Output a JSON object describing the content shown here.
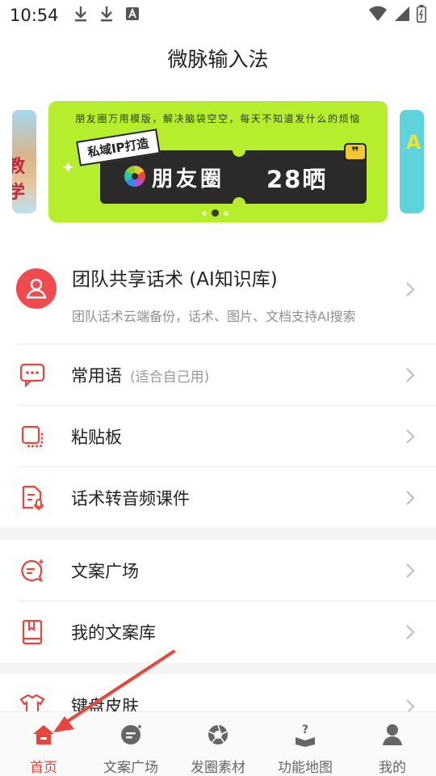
{
  "status_bar": {
    "time": "10:54"
  },
  "app_bar": {
    "title": "微脉输入法"
  },
  "banner": {
    "subtitle": "朋友圈万用模版，解决脑袋空空，每天不知道发什么的烦恼",
    "tag": "私域IP打造",
    "main_text": "朋友圈",
    "count_text": "28晒",
    "left_peek_text": "教学",
    "right_peek_text": "A",
    "dot_count": 3,
    "active_dot": 1
  },
  "team_item": {
    "title": "团队共享话术 (AI知识库)",
    "subtitle": "团队话术云端备份，话术、图片、文档支持AI搜索"
  },
  "menu_group1": [
    {
      "label": "常用语",
      "hint": "(适合自己用)",
      "icon": "chat-bubble-icon"
    },
    {
      "label": "粘贴板",
      "hint": "",
      "icon": "clipboard-icon"
    },
    {
      "label": "话术转音频课件",
      "hint": "",
      "icon": "audio-file-icon"
    }
  ],
  "menu_group2": [
    {
      "label": "文案广场",
      "hint": "",
      "icon": "sparkle-chat-icon"
    },
    {
      "label": "我的文案库",
      "hint": "",
      "icon": "book-icon"
    }
  ],
  "menu_group3": [
    {
      "label": "键盘皮肤",
      "hint": "",
      "icon": "tshirt-icon"
    }
  ],
  "tab_bar": [
    {
      "label": "首页",
      "icon": "home-icon",
      "active": true
    },
    {
      "label": "文案广场",
      "icon": "chat-icon",
      "active": false
    },
    {
      "label": "发圈素材",
      "icon": "shutter-icon",
      "active": false
    },
    {
      "label": "功能地图",
      "icon": "help-book-icon",
      "active": false
    },
    {
      "label": "我的",
      "icon": "person-icon",
      "active": false
    }
  ],
  "colors": {
    "accent": "#e8453c",
    "banner_bg": "#b6ee2d",
    "text": "#222222",
    "muted": "#999999"
  }
}
